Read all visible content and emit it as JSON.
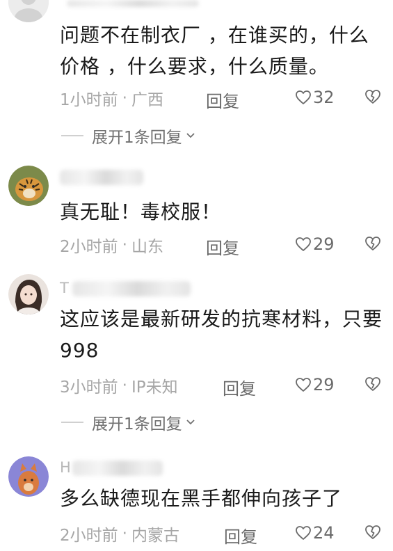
{
  "comments": [
    {
      "text": "问题不在制衣厂 ，在谁买的，什么价格 ，什么要求，什么质量。",
      "time": "1小时前",
      "location": "广西",
      "reply_label": "回复",
      "likes": "32",
      "expand_label": "展开1条回复"
    },
    {
      "text": "真无耻！毒校服！",
      "time": "2小时前",
      "location": "山东",
      "reply_label": "回复",
      "likes": "29"
    },
    {
      "username_visible": "T",
      "text": "这应该是最新研发的抗寒材料，只要998",
      "time": "3小时前",
      "location": "IP未知",
      "reply_label": "回复",
      "likes": "29",
      "expand_label": "展开1条回复"
    },
    {
      "username_visible": "H",
      "text": "多么缺德现在黑手都伸向孩子了",
      "time": "2小时前",
      "location": "内蒙古",
      "reply_label": "回复",
      "likes": "24"
    }
  ],
  "icons": {
    "like": "heart-outline-icon",
    "dislike": "broken-heart-icon",
    "expand": "chevron-down-icon"
  },
  "colors": {
    "text": "#1a1a1a",
    "meta": "#a6a6a6",
    "action": "#6a6a6a"
  }
}
